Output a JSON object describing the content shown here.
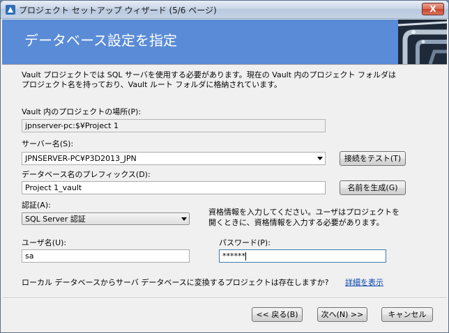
{
  "window": {
    "title": "プロジェクト セットアップ ウィザード (5/6 ページ)",
    "close_glyph": "X"
  },
  "banner": {
    "title": "データベース設定を指定"
  },
  "description": {
    "line1": "Vault プロジェクトでは SQL サーバを使用する必要があります。現在の Vault 内のプロジェクト フォルダは",
    "line2": "プロジェクト名を持っており、Vault ルート フォルダに格納されています。"
  },
  "project_location": {
    "label": "Vault 内のプロジェクトの場所(P):",
    "value": "jpnserver-pc:$¥Project 1"
  },
  "server": {
    "label": "サーバー名(S):",
    "value": "JPNSERVER-PC¥P3D2013_JPN",
    "test_button": "接続をテスト(T)"
  },
  "db_prefix": {
    "label": "データベース名のプレフィックス(D):",
    "value": "Project 1_vault",
    "generate_button": "名前を生成(G)"
  },
  "auth": {
    "label": "認証(A):",
    "value": "SQL Server 認証",
    "hint_line1": "資格情報を入力してください。ユーザはプロジェクトを",
    "hint_line2": "開くときに、資格情報を入力する必要があります。"
  },
  "username": {
    "label": "ユーザ名(U):",
    "value": "sa"
  },
  "password": {
    "label": "パスワード(P):",
    "value": "******"
  },
  "convert": {
    "question": "ローカル データベースからサーバ データベースに変換するプロジェクトは存在しますか?",
    "details_link": "詳細を表示"
  },
  "footer": {
    "back_button": "<< 戻る(B)",
    "next_button": "次へ(N) >>",
    "cancel_button": "キャンセル"
  }
}
